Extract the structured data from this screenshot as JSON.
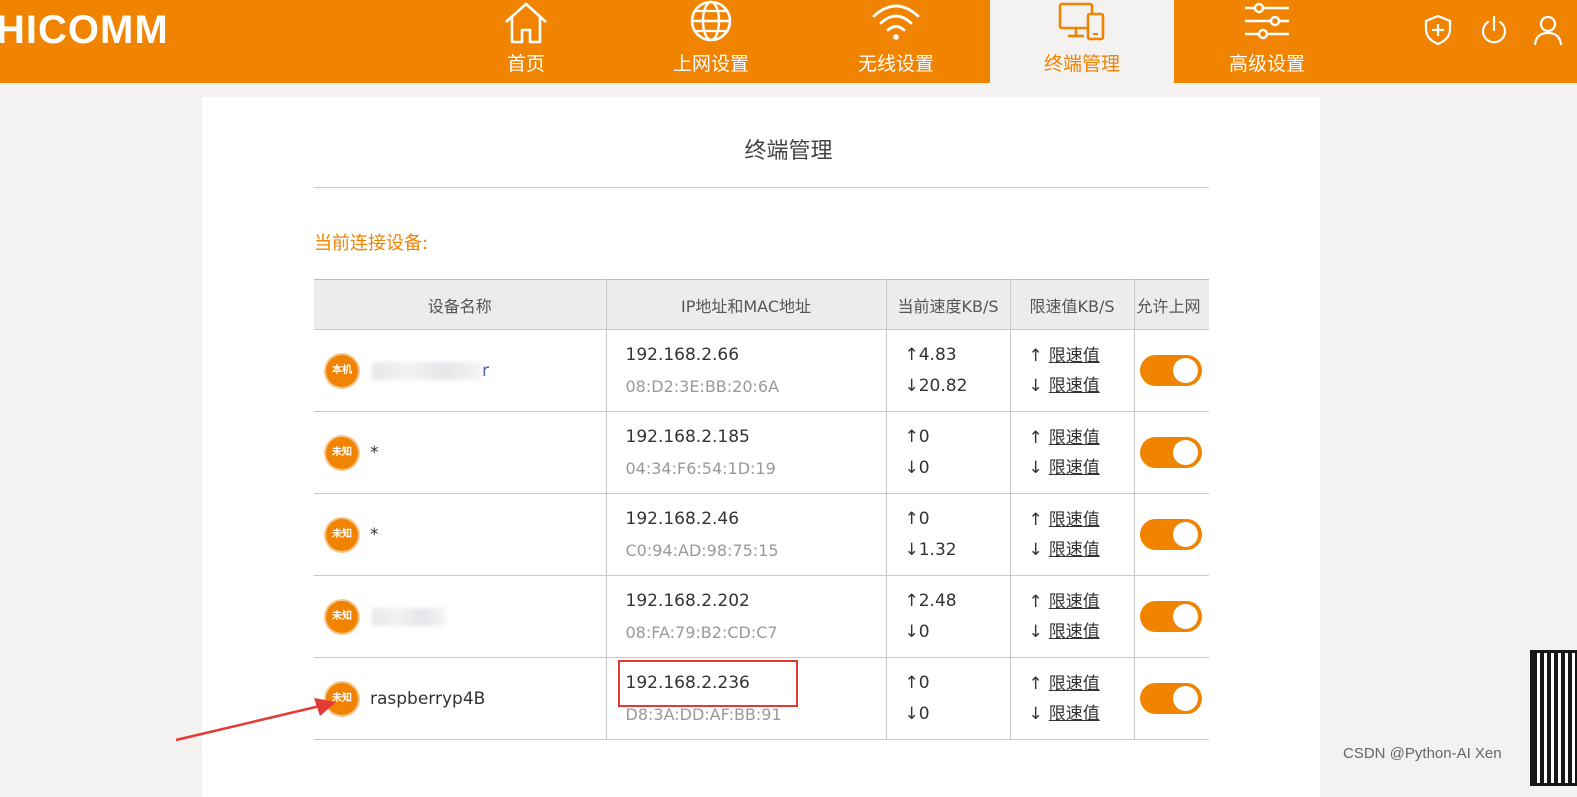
{
  "brand": {
    "logo_text": "HICOMM",
    "accent": "#f08300"
  },
  "nav": [
    {
      "label": "首页",
      "icon": "home-icon",
      "active": false
    },
    {
      "label": "上网设置",
      "icon": "globe-icon",
      "active": false
    },
    {
      "label": "无线设置",
      "icon": "wifi-icon",
      "active": false
    },
    {
      "label": "终端管理",
      "icon": "devices-icon",
      "active": true
    },
    {
      "label": "高级设置",
      "icon": "sliders-icon",
      "active": false
    }
  ],
  "top_icons": [
    "shield-plus-icon",
    "power-icon",
    "user-icon"
  ],
  "page": {
    "title": "终端管理",
    "section_label": "当前连接设备:"
  },
  "table": {
    "headers": [
      "设备名称",
      "IP地址和MAC地址",
      "当前速度KB/S",
      "限速值KB/S",
      "允许上网"
    ],
    "limit_link": "限速值",
    "rows": [
      {
        "badge": "本机",
        "name": "r",
        "ip": "192.168.2.66",
        "mac": "08:D2:3E:BB:20:6A",
        "up": "↑4.83",
        "down": "↓20.82",
        "allowed": true
      },
      {
        "badge": "未知",
        "name": "*",
        "ip": "192.168.2.185",
        "mac": "04:34:F6:54:1D:19",
        "up": "↑0",
        "down": "↓0",
        "allowed": true
      },
      {
        "badge": "未知",
        "name": "*",
        "ip": "192.168.2.46",
        "mac": "C0:94:AD:98:75:15",
        "up": "↑0",
        "down": "↓1.32",
        "allowed": true
      },
      {
        "badge": "未知",
        "name": "",
        "ip": "192.168.2.202",
        "mac": "08:FA:79:B2:CD:C7",
        "up": "↑2.48",
        "down": "↓0",
        "allowed": true
      },
      {
        "badge": "未知",
        "name": "raspberryp4B",
        "ip": "192.168.2.236",
        "mac": "D8:3A:DD:AF:BB:91",
        "up": "↑0",
        "down": "↓0",
        "allowed": true
      }
    ]
  },
  "watermark": "CSDN @Python-AI Xen"
}
